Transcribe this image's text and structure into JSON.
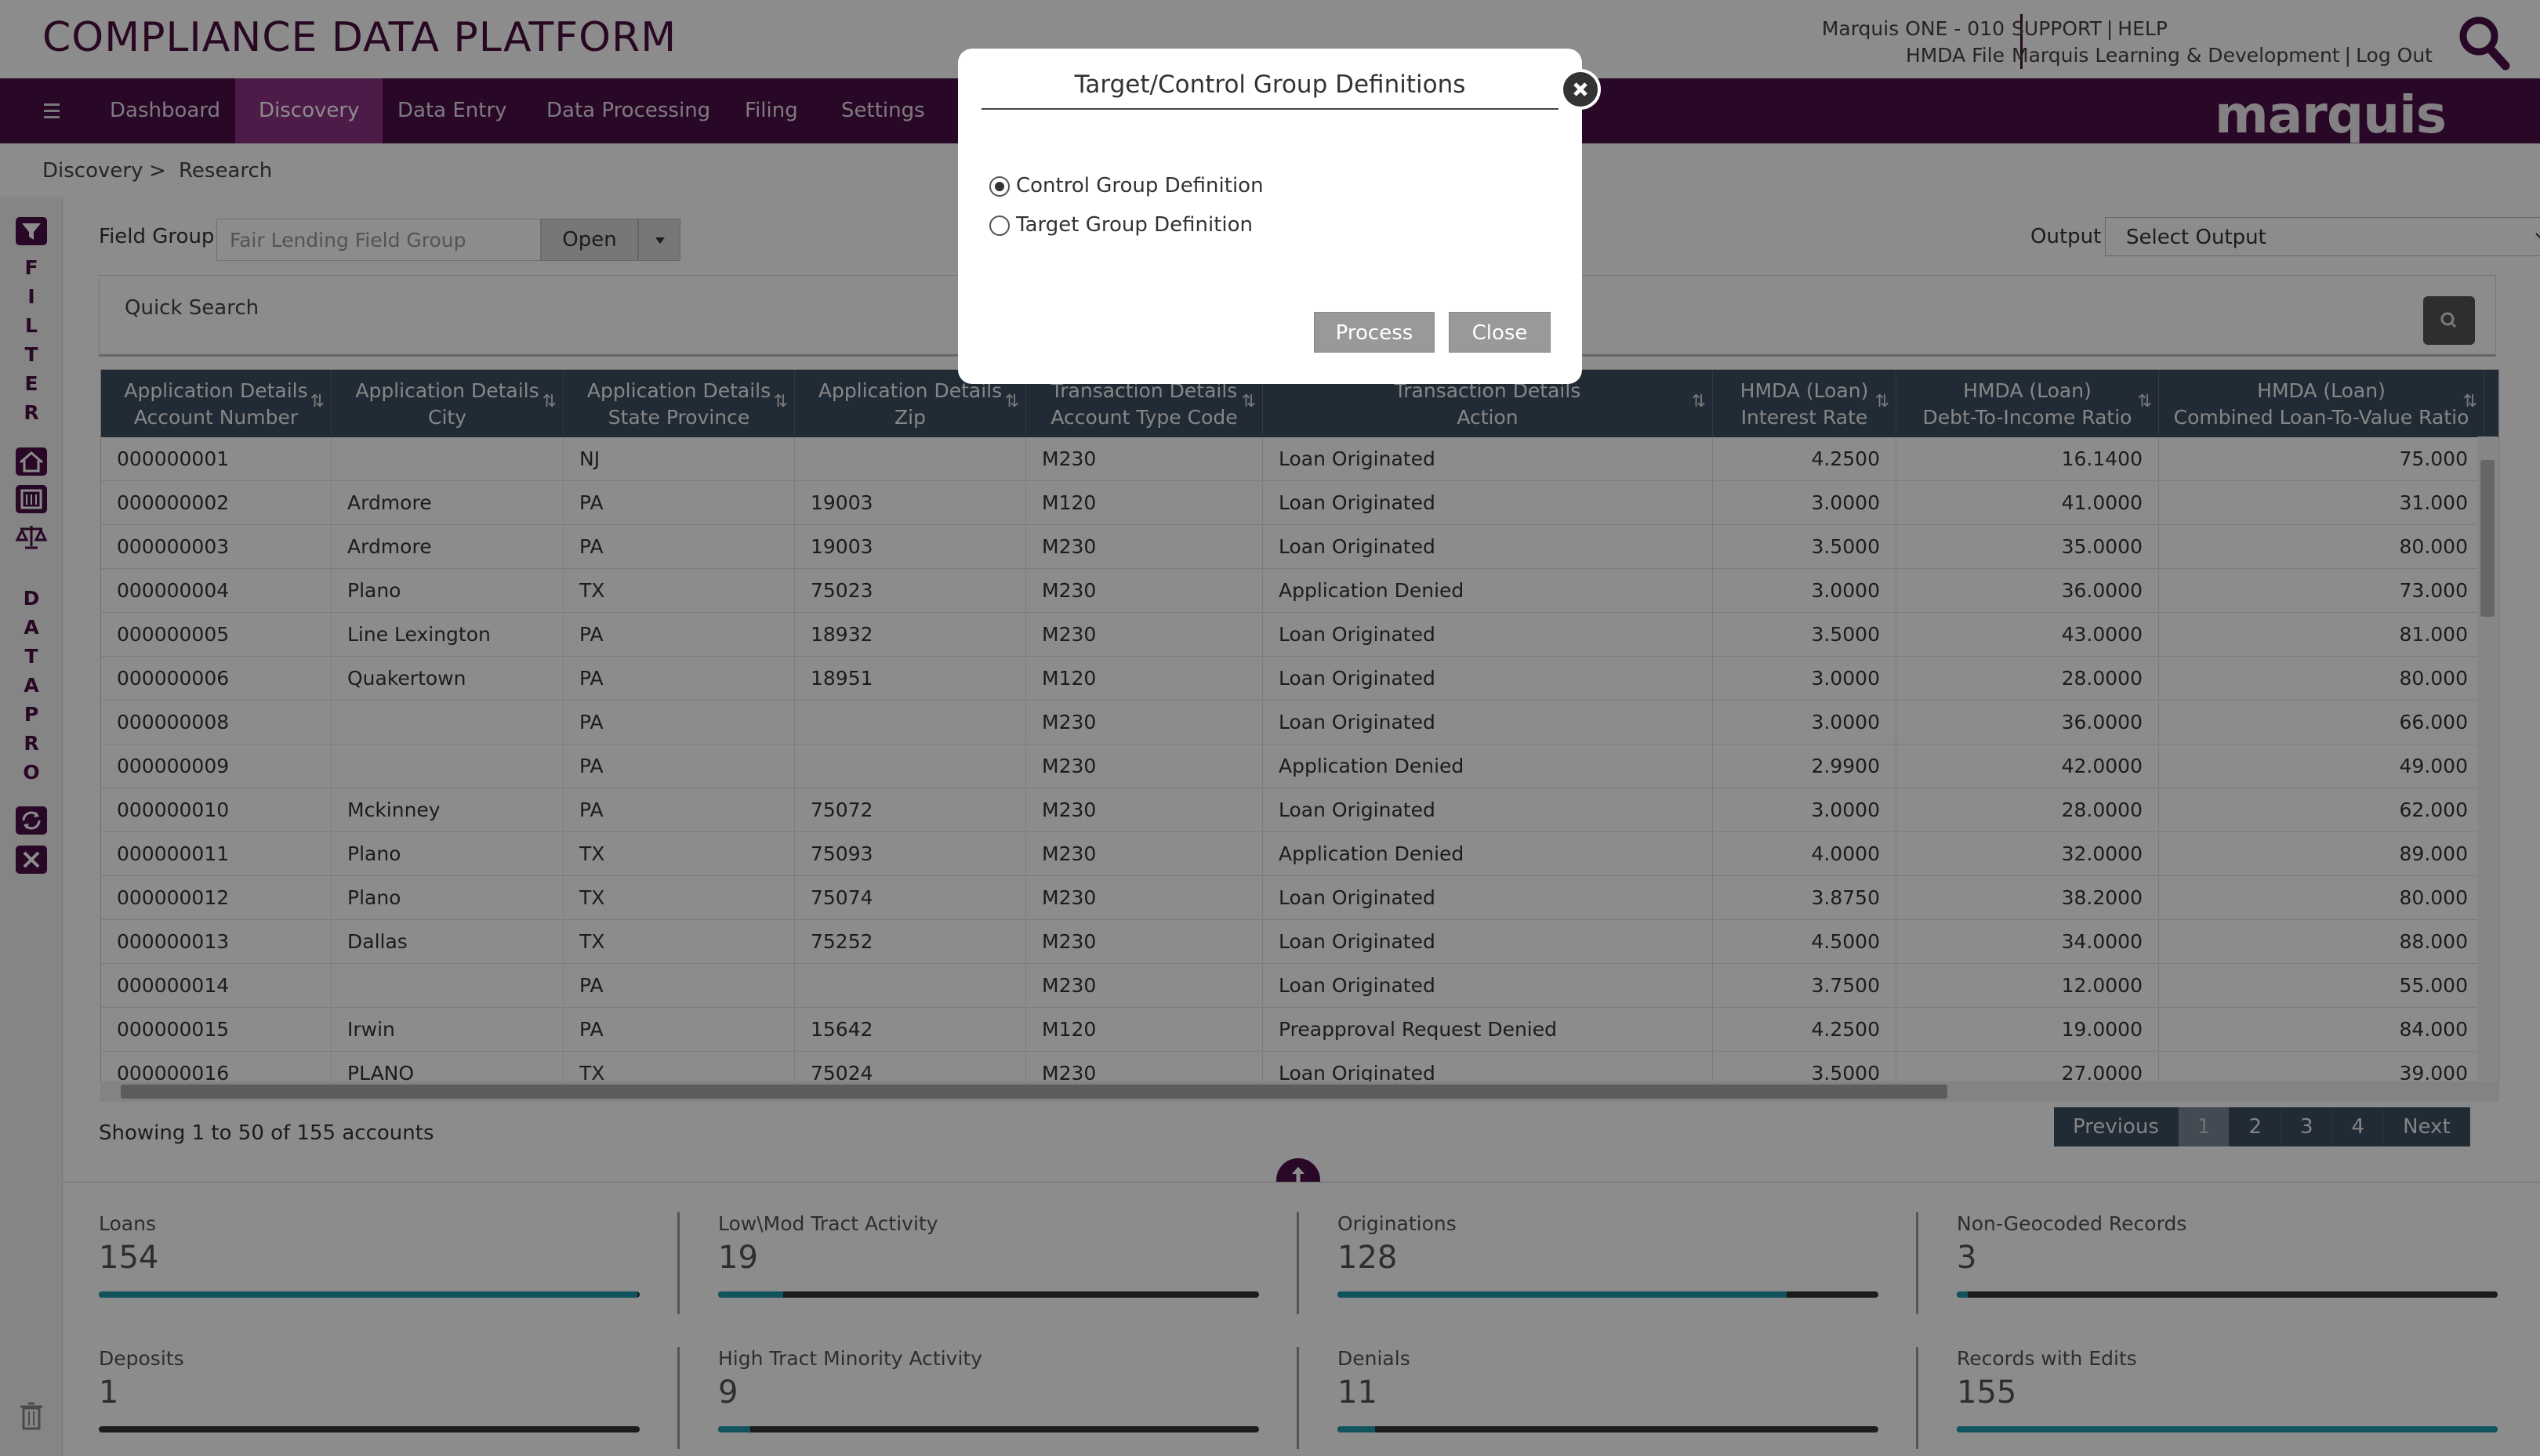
{
  "header": {
    "title": "COMPLIANCE DATA PLATFORM",
    "institution": "Marquis ONE - 010",
    "file_type": "HMDA File",
    "support": "SUPPORT",
    "help": "HELP",
    "org": "Marquis Learning & Development",
    "logout": "Log Out",
    "sep": "|"
  },
  "nav": {
    "items": [
      "Dashboard",
      "Discovery",
      "Data Entry",
      "Data Processing",
      "Filing",
      "Settings"
    ],
    "active": "Discovery",
    "brand": "marquis"
  },
  "breadcrumb": {
    "root": "Discovery",
    "sep": ">",
    "current": "Research"
  },
  "sidebar": {
    "filter_letters": [
      "F",
      "I",
      "L",
      "T",
      "E",
      "R"
    ],
    "datapro_letters": [
      "D",
      "A",
      "T",
      "A",
      "P",
      "R",
      "O"
    ]
  },
  "toolbar": {
    "field_group_label": "Field Group",
    "field_group_placeholder": "Fair Lending Field Group",
    "open_label": "Open",
    "output_label": "Output",
    "output_value": "Select Output"
  },
  "quick_search": {
    "label": "Quick Search"
  },
  "grid": {
    "columns": [
      {
        "l1": "Application Details",
        "l2": "Account Number"
      },
      {
        "l1": "Application Details",
        "l2": "City"
      },
      {
        "l1": "Application Details",
        "l2": "State Province"
      },
      {
        "l1": "Application Details",
        "l2": "Zip"
      },
      {
        "l1": "Transaction Details",
        "l2": "Account Type Code"
      },
      {
        "l1": "Transaction Details",
        "l2": "Action"
      },
      {
        "l1": "HMDA (Loan)",
        "l2": "Interest Rate"
      },
      {
        "l1": "HMDA (Loan)",
        "l2": "Debt-To-Income Ratio"
      },
      {
        "l1": "HMDA (Loan)",
        "l2": "Combined Loan-To-Value Ratio"
      }
    ],
    "rows": [
      [
        "000000001",
        "",
        "NJ",
        "",
        "M230",
        "Loan Originated",
        "4.2500",
        "16.1400",
        "75.000"
      ],
      [
        "000000002",
        "Ardmore",
        "PA",
        "19003",
        "M120",
        "Loan Originated",
        "3.0000",
        "41.0000",
        "31.000"
      ],
      [
        "000000003",
        "Ardmore",
        "PA",
        "19003",
        "M230",
        "Loan Originated",
        "3.5000",
        "35.0000",
        "80.000"
      ],
      [
        "000000004",
        "Plano",
        "TX",
        "75023",
        "M230",
        "Application Denied",
        "3.0000",
        "36.0000",
        "73.000"
      ],
      [
        "000000005",
        "Line Lexington",
        "PA",
        "18932",
        "M230",
        "Loan Originated",
        "3.5000",
        "43.0000",
        "81.000"
      ],
      [
        "000000006",
        "Quakertown",
        "PA",
        "18951",
        "M120",
        "Loan Originated",
        "3.0000",
        "28.0000",
        "80.000"
      ],
      [
        "000000008",
        "",
        "PA",
        "",
        "M230",
        "Loan Originated",
        "3.0000",
        "36.0000",
        "66.000"
      ],
      [
        "000000009",
        "",
        "PA",
        "",
        "M230",
        "Application Denied",
        "2.9900",
        "42.0000",
        "49.000"
      ],
      [
        "000000010",
        "Mckinney",
        "PA",
        "75072",
        "M230",
        "Loan Originated",
        "3.0000",
        "28.0000",
        "62.000"
      ],
      [
        "000000011",
        "Plano",
        "TX",
        "75093",
        "M230",
        "Application Denied",
        "4.0000",
        "32.0000",
        "89.000"
      ],
      [
        "000000012",
        "Plano",
        "TX",
        "75074",
        "M230",
        "Loan Originated",
        "3.8750",
        "38.2000",
        "80.000"
      ],
      [
        "000000013",
        "Dallas",
        "TX",
        "75252",
        "M230",
        "Loan Originated",
        "4.5000",
        "34.0000",
        "88.000"
      ],
      [
        "000000014",
        "",
        "PA",
        "",
        "M230",
        "Loan Originated",
        "3.7500",
        "12.0000",
        "55.000"
      ],
      [
        "000000015",
        "Irwin",
        "PA",
        "15642",
        "M120",
        "Preapproval Request Denied",
        "4.2500",
        "19.0000",
        "84.000"
      ],
      [
        "000000016",
        "PLANO",
        "TX",
        "75024",
        "M230",
        "Loan Originated",
        "3.5000",
        "27.0000",
        "39.000"
      ]
    ],
    "showing": "Showing 1 to 50 of 155 accounts"
  },
  "pager": {
    "previous": "Previous",
    "pages": [
      "1",
      "2",
      "3",
      "4"
    ],
    "active": "1",
    "next": "Next"
  },
  "stats": [
    {
      "label": "Loans",
      "value": "154",
      "fill": 0.995
    },
    {
      "label": "Low\\Mod Tract Activity",
      "value": "19",
      "fill": 0.12
    },
    {
      "label": "Originations",
      "value": "128",
      "fill": 0.83
    },
    {
      "label": "Non-Geocoded Records",
      "value": "3",
      "fill": 0.02
    },
    {
      "label": "Deposits",
      "value": "1",
      "fill": 0.0
    },
    {
      "label": "High Tract Minority Activity",
      "value": "9",
      "fill": 0.06
    },
    {
      "label": "Denials",
      "value": "11",
      "fill": 0.07
    },
    {
      "label": "Records with Edits",
      "value": "155",
      "fill": 1.0
    }
  ],
  "modal": {
    "title": "Target/Control Group Definitions",
    "options": [
      "Control Group Definition",
      "Target Group Definition"
    ],
    "selected": "Control Group Definition",
    "process_label": "Process",
    "close_label": "Close"
  },
  "colors": {
    "brand_purple": "#4a0f45",
    "active_tab": "#8a3283",
    "grid_header": "#3d4f63",
    "stat_fill": "#1f9aaa"
  }
}
